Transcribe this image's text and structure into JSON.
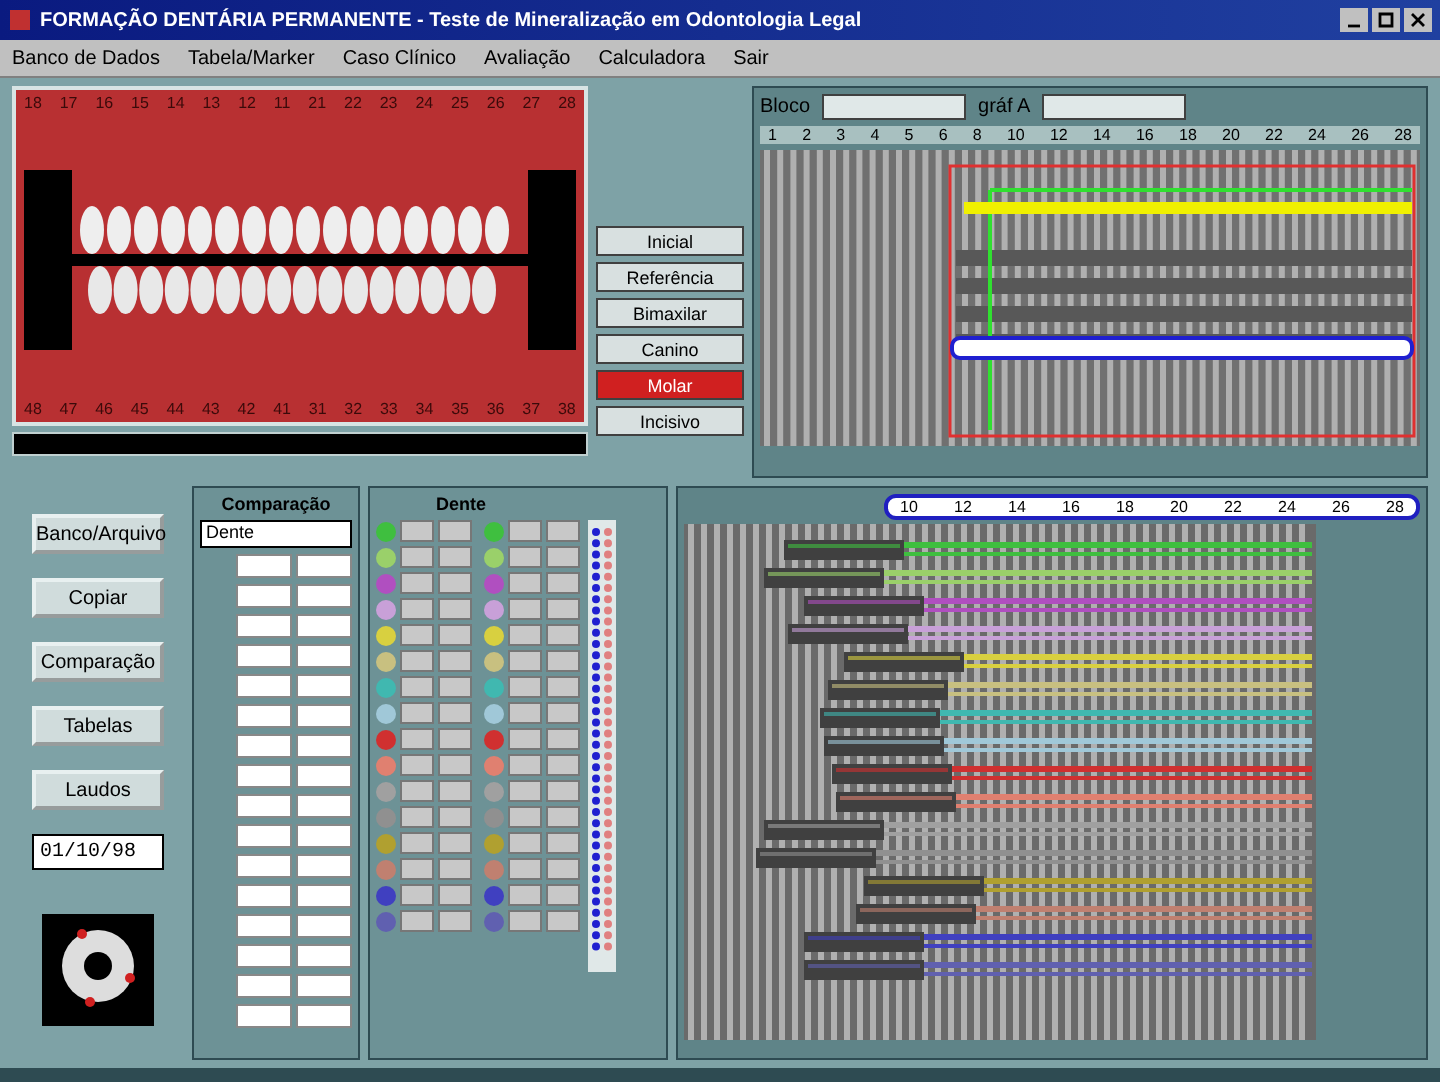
{
  "window": {
    "title": "FORMAÇÃO DENTÁRIA PERMANENTE - Teste de Mineralização em Odontologia Legal"
  },
  "menu": [
    "Banco de Dados",
    "Tabela/Marker",
    "Caso Clínico",
    "Avaliação",
    "Calculadora",
    "Sair"
  ],
  "photo": {
    "upper_teeth": [
      "18",
      "17",
      "16",
      "15",
      "14",
      "13",
      "12",
      "11",
      "21",
      "22",
      "23",
      "24",
      "25",
      "26",
      "27",
      "28"
    ],
    "lower_teeth": [
      "48",
      "47",
      "46",
      "45",
      "44",
      "43",
      "42",
      "41",
      "31",
      "32",
      "33",
      "34",
      "35",
      "36",
      "37",
      "38"
    ]
  },
  "stages": [
    {
      "label": "Inicial",
      "selected": false
    },
    {
      "label": "Referência",
      "selected": false
    },
    {
      "label": "Bimaxilar",
      "selected": false
    },
    {
      "label": "Canino",
      "selected": false
    },
    {
      "label": "Molar",
      "selected": true
    },
    {
      "label": "Incisivo",
      "selected": false
    }
  ],
  "top_chart": {
    "block_label": "Bloco",
    "graph_label": "gráf A",
    "ticks": [
      "1",
      "2",
      "3",
      "4",
      "5",
      "6",
      "8",
      "10",
      "12",
      "14",
      "16",
      "18",
      "20",
      "22",
      "24",
      "26",
      "28"
    ]
  },
  "side_buttons": [
    "Banco/Arquivo",
    "Copiar",
    "Comparação",
    "Tabelas",
    "Laudos"
  ],
  "date_field": {
    "value": "01/10/98"
  },
  "comparison": {
    "title": "Comparação",
    "select": "Dente"
  },
  "teeth_table": {
    "title": "Dente",
    "rows": [
      {
        "color": "#3fbf3f"
      },
      {
        "color": "#9ad06a"
      },
      {
        "color": "#b04fc0"
      },
      {
        "color": "#c8a0d8"
      },
      {
        "color": "#d8d040"
      },
      {
        "color": "#c8c080"
      },
      {
        "color": "#40b8b0"
      },
      {
        "color": "#a0c8d8"
      },
      {
        "color": "#d03030"
      },
      {
        "color": "#e08070"
      },
      {
        "color": "#a0a0a0"
      },
      {
        "color": "#909090"
      },
      {
        "color": "#b0a030"
      },
      {
        "color": "#c08070"
      },
      {
        "color": "#4040c0"
      },
      {
        "color": "#6060b0"
      }
    ]
  },
  "bottom_chart": {
    "ticks": [
      "10",
      "12",
      "14",
      "16",
      "18",
      "20",
      "22",
      "24",
      "26",
      "28"
    ]
  }
}
